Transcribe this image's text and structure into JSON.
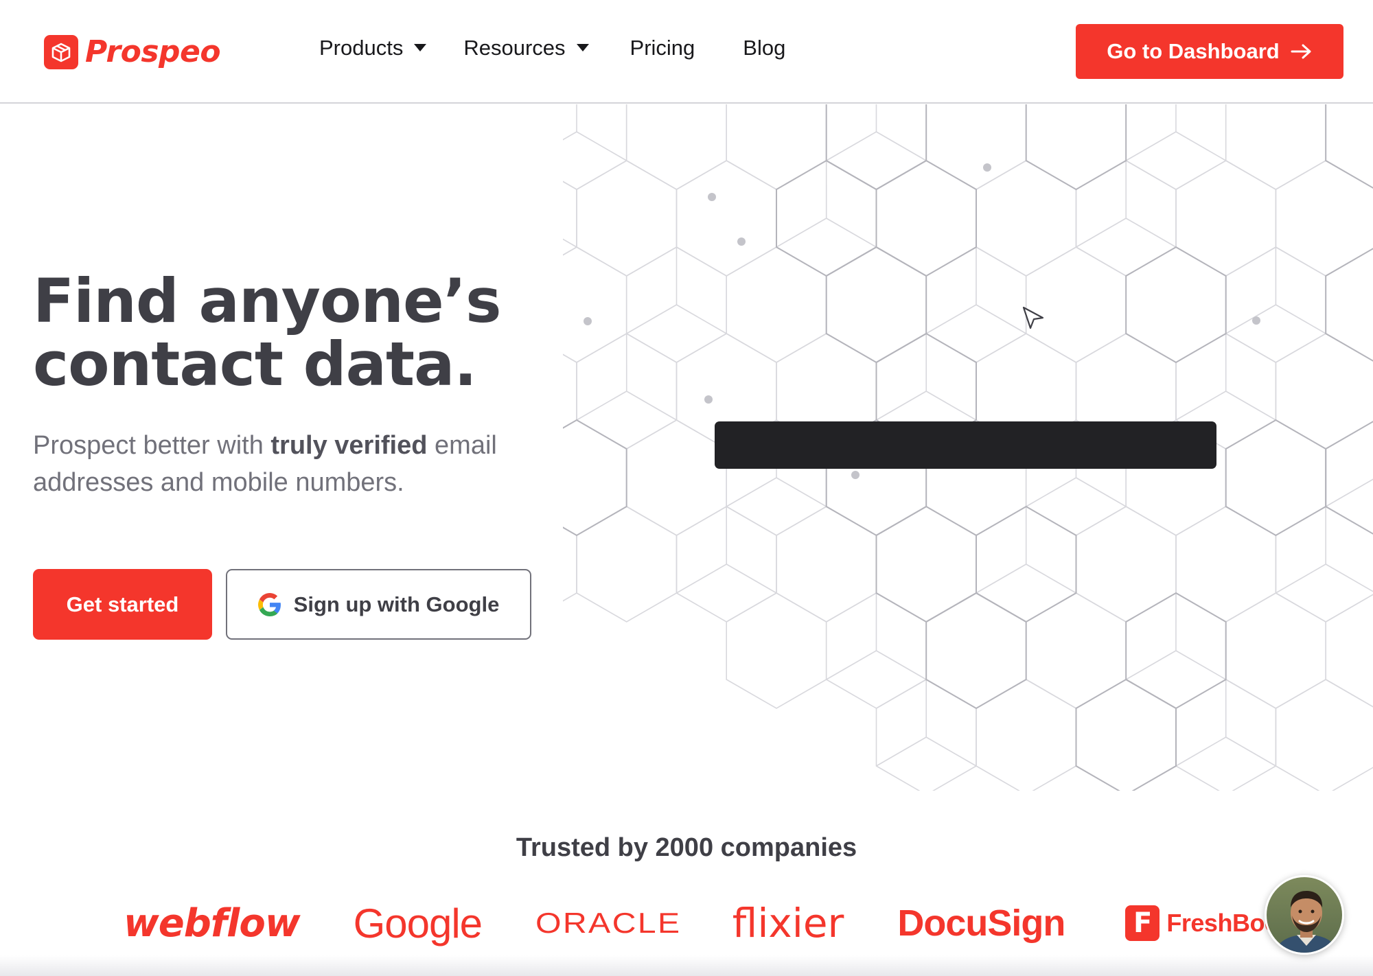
{
  "brand": {
    "name": "Prospeo",
    "accent_color": "#f4362c",
    "logo_icon": "cube-logo-icon"
  },
  "nav": {
    "items": [
      {
        "label": "Products",
        "has_dropdown": true
      },
      {
        "label": "Resources",
        "has_dropdown": true
      },
      {
        "label": "Pricing",
        "has_dropdown": false
      },
      {
        "label": "Blog",
        "has_dropdown": false
      }
    ],
    "dashboard_button": {
      "label": "Go to Dashboard",
      "icon": "arrow-right-icon"
    }
  },
  "hero": {
    "title": "Find anyone’s contact data.",
    "subtitle_prefix": "Prospect better with ",
    "subtitle_bold": "truly verified",
    "subtitle_suffix": " email addresses and mobile numbers.",
    "primary_button": "Get started",
    "google_button": "Sign up with Google",
    "google_icon": "google-g-icon"
  },
  "trusted": {
    "title": "Trusted by 2000 companies",
    "logos": [
      "webflow",
      "Google",
      "ORACLE",
      "flixier",
      "DocuSign",
      "FreshBooks"
    ]
  },
  "chat_widget": {
    "icon": "avatar-chat-icon"
  }
}
